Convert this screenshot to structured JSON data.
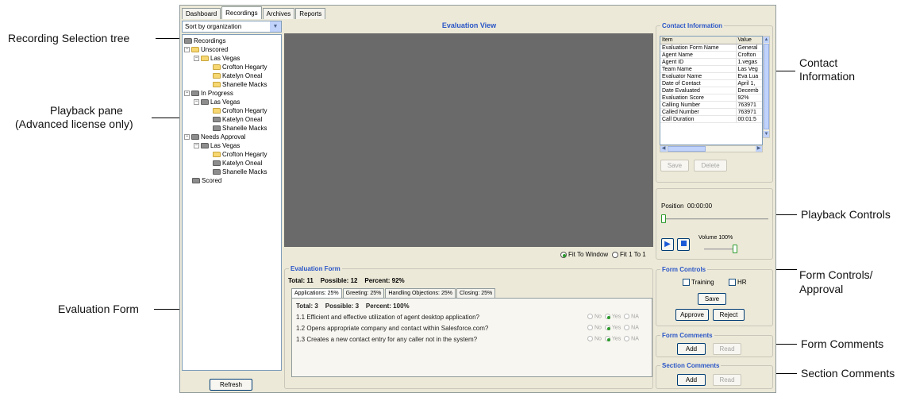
{
  "callouts": {
    "recording_tree": "Recording Selection tree",
    "playback_pane_line1": "Playback pane",
    "playback_pane_line2": "(Advanced license only)",
    "evaluation_form": "Evaluation Form",
    "contact_info_line1": "Contact",
    "contact_info_line2": "Information",
    "playback_controls": "Playback Controls",
    "form_controls_line1": "Form Controls/",
    "form_controls_line2": "Approval",
    "form_comments": "Form Comments",
    "section_comments": "Section Comments"
  },
  "tabs": [
    "Dashboard",
    "Recordings",
    "Archives",
    "Reports"
  ],
  "sort": {
    "value": "Sort by organization"
  },
  "tree": {
    "root": "Recordings",
    "unscored": "Unscored",
    "in_progress": "In Progress",
    "needs_approval": "Needs Approval",
    "scored": "Scored",
    "site": "Las Vegas",
    "agents": [
      "Crofton Hegarty",
      "Katelyn Oneal",
      "Shanelle Macks"
    ]
  },
  "refresh_label": "Refresh",
  "evaluation_view_title": "Evaluation View",
  "fit": {
    "window": "Fit To Window",
    "one": "Fit 1 To 1"
  },
  "contact_info": {
    "title": "Contact Information",
    "col_item": "Item",
    "col_value": "Value",
    "rows": [
      [
        "Evaluation Form Name",
        "General"
      ],
      [
        "Agent Name",
        "Crofton"
      ],
      [
        "Agent ID",
        "1.vegas"
      ],
      [
        "Team Name",
        "Las Veg"
      ],
      [
        "Evaluator Name",
        "Eva Lua"
      ],
      [
        "Date of Contact",
        "April 1,"
      ],
      [
        "Date Evaluated",
        "Decemb"
      ],
      [
        "Evaluation Score",
        "92%"
      ],
      [
        "Calling Number",
        "763971"
      ],
      [
        "Called Number",
        "763971"
      ],
      [
        "Call Duration",
        "00:01:5"
      ]
    ],
    "save": "Save",
    "delete": "Delete"
  },
  "playback": {
    "position_label": "Position",
    "position_value": "00:00:00",
    "volume_label": "Volume",
    "volume_value": "100%",
    "volume_level": 1.0,
    "position_level": 0.0
  },
  "eval_form": {
    "title": "Evaluation Form",
    "total_label": "Total:",
    "total": "11",
    "possible_label": "Possible:",
    "possible": "12",
    "percent_label": "Percent:",
    "percent": "92%",
    "tabs": [
      "Applications: 25%",
      "Greeting: 25%",
      "Handling Objections: 25%",
      "Closing: 25%"
    ],
    "section_total": "3",
    "section_possible": "3",
    "section_percent": "100%",
    "questions": [
      "1.1 Efficient and effective utilization of agent desktop application?",
      "1.2 Opens appropriate company and contact within Salesforce.com?",
      "1.3 Creates a new contact entry for any caller not in the system?"
    ],
    "opt_no": "No",
    "opt_yes": "Yes",
    "opt_na": "NA"
  },
  "form_controls": {
    "title": "Form Controls",
    "training": "Training",
    "hr": "HR",
    "save": "Save",
    "approve": "Approve",
    "reject": "Reject"
  },
  "form_comments": {
    "title": "Form Comments",
    "add": "Add",
    "read": "Read"
  },
  "section_comments": {
    "title": "Section Comments",
    "add": "Add",
    "read": "Read"
  }
}
